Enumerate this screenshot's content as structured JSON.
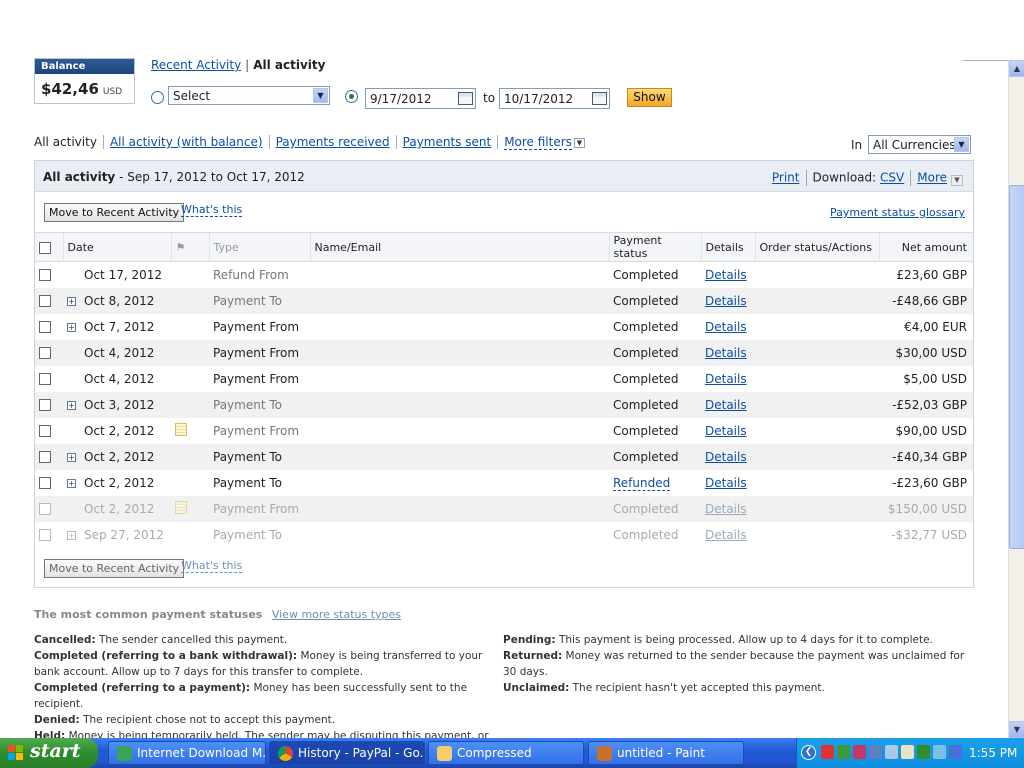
{
  "balance": {
    "label": "Balance",
    "amount": "$42,46",
    "currency": "USD"
  },
  "activity_links": {
    "recent": "Recent Activity",
    "all": "All activity"
  },
  "date_filter": {
    "select_label": "Select",
    "from": "9/17/2012",
    "to_label": "to",
    "to": "10/17/2012",
    "show": "Show"
  },
  "filters": {
    "tabs": [
      "All activity",
      "All activity (with balance)",
      "Payments received",
      "Payments sent",
      "More filters"
    ],
    "in_label": "In",
    "currency": "All Currencies"
  },
  "panel": {
    "title": "All activity",
    "range": " - Sep 17, 2012 to Oct 17, 2012",
    "print": "Print",
    "download_label": "Download:",
    "csv": "CSV",
    "more": "More",
    "move_button": "Move to Recent Activity",
    "whats_this": "What's this",
    "glossary": "Payment status glossary"
  },
  "table": {
    "headers": [
      "Date",
      "Type",
      "Name/Email",
      "Payment status",
      "Details",
      "Order status/Actions",
      "Net amount"
    ],
    "rows": [
      {
        "date": "Oct 17, 2012",
        "type": "Refund From",
        "status": "Completed",
        "details": "Details",
        "net": "£23,60 GBP"
      },
      {
        "date": "Oct 8, 2012",
        "type": "Payment To",
        "status": "Completed",
        "details": "Details",
        "net": "-£48,66 GBP"
      },
      {
        "date": "Oct 7, 2012",
        "type": "Payment From",
        "status": "Completed",
        "details": "Details",
        "net": "€4,00 EUR"
      },
      {
        "date": "Oct 4, 2012",
        "type": "Payment From",
        "status": "Completed",
        "details": "Details",
        "net": "$30,00 USD"
      },
      {
        "date": "Oct 4, 2012",
        "type": "Payment From",
        "status": "Completed",
        "details": "Details",
        "net": "$5,00 USD"
      },
      {
        "date": "Oct 3, 2012",
        "type": "Payment To",
        "status": "Completed",
        "details": "Details",
        "net": "-£52,03 GBP"
      },
      {
        "date": "Oct 2, 2012",
        "type": "Payment From",
        "status": "Completed",
        "details": "Details",
        "net": "$90,00 USD"
      },
      {
        "date": "Oct 2, 2012",
        "type": "Payment To",
        "status": "Completed",
        "details": "Details",
        "net": "-£40,34 GBP"
      },
      {
        "date": "Oct 2, 2012",
        "type": "Payment To",
        "status": "Refunded",
        "details": "Details",
        "net": "-£23,60 GBP"
      },
      {
        "date": "Oct 2, 2012",
        "type": "Payment From",
        "status": "Completed",
        "details": "Details",
        "net": "$150,00 USD"
      },
      {
        "date": "Sep 27, 2012",
        "type": "Payment To",
        "status": "Completed",
        "details": "Details",
        "net": "-$32,77 USD"
      }
    ]
  },
  "statuses": {
    "heading": "The most common payment statuses",
    "more_link": "View more status types",
    "left": [
      {
        "term": "Cancelled:",
        "desc": "The sender cancelled this payment."
      },
      {
        "term": "Completed (referring to a bank withdrawal):",
        "desc": "Money is being transferred to your bank account. Allow up to 7 days for this transfer to complete."
      },
      {
        "term": "Completed (referring to a payment):",
        "desc": "Money has been successfully sent to the recipient."
      },
      {
        "term": "Denied:",
        "desc": "The recipient chose not to accept this payment."
      },
      {
        "term": "Held:",
        "desc": "Money is being temporarily held. The sender may be disputing this payment, or the payment may be under review by PayPal."
      }
    ],
    "right": [
      {
        "term": "Pending:",
        "desc": "This payment is being processed. Allow up to 4 days for it to complete."
      },
      {
        "term": "Returned:",
        "desc": "Money was returned to the sender because the payment was unclaimed for 30 days."
      },
      {
        "term": "Unclaimed:",
        "desc": "The recipient hasn't yet accepted this payment."
      }
    ]
  },
  "taskbar": {
    "start": "start",
    "tasks": [
      "Internet Download M...",
      "History - PayPal - Go...",
      "Compressed",
      "untitled - Paint"
    ],
    "clock": "1:55 PM"
  },
  "colors": {
    "link": "#0b4fa8",
    "show_button": "#f4a623",
    "taskbar": "#2459d6",
    "start": "#2e8b2e"
  }
}
